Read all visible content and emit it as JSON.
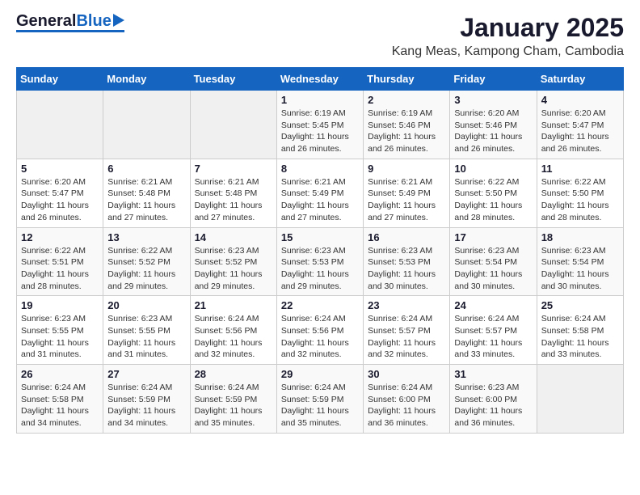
{
  "header": {
    "logo_general": "General",
    "logo_blue": "Blue",
    "month_title": "January 2025",
    "location": "Kang Meas, Kampong Cham, Cambodia"
  },
  "days_of_week": [
    "Sunday",
    "Monday",
    "Tuesday",
    "Wednesday",
    "Thursday",
    "Friday",
    "Saturday"
  ],
  "weeks": [
    [
      {
        "day": "",
        "sunrise": "",
        "sunset": "",
        "daylight": ""
      },
      {
        "day": "",
        "sunrise": "",
        "sunset": "",
        "daylight": ""
      },
      {
        "day": "",
        "sunrise": "",
        "sunset": "",
        "daylight": ""
      },
      {
        "day": "1",
        "sunrise": "Sunrise: 6:19 AM",
        "sunset": "Sunset: 5:45 PM",
        "daylight": "Daylight: 11 hours and 26 minutes."
      },
      {
        "day": "2",
        "sunrise": "Sunrise: 6:19 AM",
        "sunset": "Sunset: 5:46 PM",
        "daylight": "Daylight: 11 hours and 26 minutes."
      },
      {
        "day": "3",
        "sunrise": "Sunrise: 6:20 AM",
        "sunset": "Sunset: 5:46 PM",
        "daylight": "Daylight: 11 hours and 26 minutes."
      },
      {
        "day": "4",
        "sunrise": "Sunrise: 6:20 AM",
        "sunset": "Sunset: 5:47 PM",
        "daylight": "Daylight: 11 hours and 26 minutes."
      }
    ],
    [
      {
        "day": "5",
        "sunrise": "Sunrise: 6:20 AM",
        "sunset": "Sunset: 5:47 PM",
        "daylight": "Daylight: 11 hours and 26 minutes."
      },
      {
        "day": "6",
        "sunrise": "Sunrise: 6:21 AM",
        "sunset": "Sunset: 5:48 PM",
        "daylight": "Daylight: 11 hours and 27 minutes."
      },
      {
        "day": "7",
        "sunrise": "Sunrise: 6:21 AM",
        "sunset": "Sunset: 5:48 PM",
        "daylight": "Daylight: 11 hours and 27 minutes."
      },
      {
        "day": "8",
        "sunrise": "Sunrise: 6:21 AM",
        "sunset": "Sunset: 5:49 PM",
        "daylight": "Daylight: 11 hours and 27 minutes."
      },
      {
        "day": "9",
        "sunrise": "Sunrise: 6:21 AM",
        "sunset": "Sunset: 5:49 PM",
        "daylight": "Daylight: 11 hours and 27 minutes."
      },
      {
        "day": "10",
        "sunrise": "Sunrise: 6:22 AM",
        "sunset": "Sunset: 5:50 PM",
        "daylight": "Daylight: 11 hours and 28 minutes."
      },
      {
        "day": "11",
        "sunrise": "Sunrise: 6:22 AM",
        "sunset": "Sunset: 5:50 PM",
        "daylight": "Daylight: 11 hours and 28 minutes."
      }
    ],
    [
      {
        "day": "12",
        "sunrise": "Sunrise: 6:22 AM",
        "sunset": "Sunset: 5:51 PM",
        "daylight": "Daylight: 11 hours and 28 minutes."
      },
      {
        "day": "13",
        "sunrise": "Sunrise: 6:22 AM",
        "sunset": "Sunset: 5:52 PM",
        "daylight": "Daylight: 11 hours and 29 minutes."
      },
      {
        "day": "14",
        "sunrise": "Sunrise: 6:23 AM",
        "sunset": "Sunset: 5:52 PM",
        "daylight": "Daylight: 11 hours and 29 minutes."
      },
      {
        "day": "15",
        "sunrise": "Sunrise: 6:23 AM",
        "sunset": "Sunset: 5:53 PM",
        "daylight": "Daylight: 11 hours and 29 minutes."
      },
      {
        "day": "16",
        "sunrise": "Sunrise: 6:23 AM",
        "sunset": "Sunset: 5:53 PM",
        "daylight": "Daylight: 11 hours and 30 minutes."
      },
      {
        "day": "17",
        "sunrise": "Sunrise: 6:23 AM",
        "sunset": "Sunset: 5:54 PM",
        "daylight": "Daylight: 11 hours and 30 minutes."
      },
      {
        "day": "18",
        "sunrise": "Sunrise: 6:23 AM",
        "sunset": "Sunset: 5:54 PM",
        "daylight": "Daylight: 11 hours and 30 minutes."
      }
    ],
    [
      {
        "day": "19",
        "sunrise": "Sunrise: 6:23 AM",
        "sunset": "Sunset: 5:55 PM",
        "daylight": "Daylight: 11 hours and 31 minutes."
      },
      {
        "day": "20",
        "sunrise": "Sunrise: 6:23 AM",
        "sunset": "Sunset: 5:55 PM",
        "daylight": "Daylight: 11 hours and 31 minutes."
      },
      {
        "day": "21",
        "sunrise": "Sunrise: 6:24 AM",
        "sunset": "Sunset: 5:56 PM",
        "daylight": "Daylight: 11 hours and 32 minutes."
      },
      {
        "day": "22",
        "sunrise": "Sunrise: 6:24 AM",
        "sunset": "Sunset: 5:56 PM",
        "daylight": "Daylight: 11 hours and 32 minutes."
      },
      {
        "day": "23",
        "sunrise": "Sunrise: 6:24 AM",
        "sunset": "Sunset: 5:57 PM",
        "daylight": "Daylight: 11 hours and 32 minutes."
      },
      {
        "day": "24",
        "sunrise": "Sunrise: 6:24 AM",
        "sunset": "Sunset: 5:57 PM",
        "daylight": "Daylight: 11 hours and 33 minutes."
      },
      {
        "day": "25",
        "sunrise": "Sunrise: 6:24 AM",
        "sunset": "Sunset: 5:58 PM",
        "daylight": "Daylight: 11 hours and 33 minutes."
      }
    ],
    [
      {
        "day": "26",
        "sunrise": "Sunrise: 6:24 AM",
        "sunset": "Sunset: 5:58 PM",
        "daylight": "Daylight: 11 hours and 34 minutes."
      },
      {
        "day": "27",
        "sunrise": "Sunrise: 6:24 AM",
        "sunset": "Sunset: 5:59 PM",
        "daylight": "Daylight: 11 hours and 34 minutes."
      },
      {
        "day": "28",
        "sunrise": "Sunrise: 6:24 AM",
        "sunset": "Sunset: 5:59 PM",
        "daylight": "Daylight: 11 hours and 35 minutes."
      },
      {
        "day": "29",
        "sunrise": "Sunrise: 6:24 AM",
        "sunset": "Sunset: 5:59 PM",
        "daylight": "Daylight: 11 hours and 35 minutes."
      },
      {
        "day": "30",
        "sunrise": "Sunrise: 6:24 AM",
        "sunset": "Sunset: 6:00 PM",
        "daylight": "Daylight: 11 hours and 36 minutes."
      },
      {
        "day": "31",
        "sunrise": "Sunrise: 6:23 AM",
        "sunset": "Sunset: 6:00 PM",
        "daylight": "Daylight: 11 hours and 36 minutes."
      },
      {
        "day": "",
        "sunrise": "",
        "sunset": "",
        "daylight": ""
      }
    ]
  ]
}
